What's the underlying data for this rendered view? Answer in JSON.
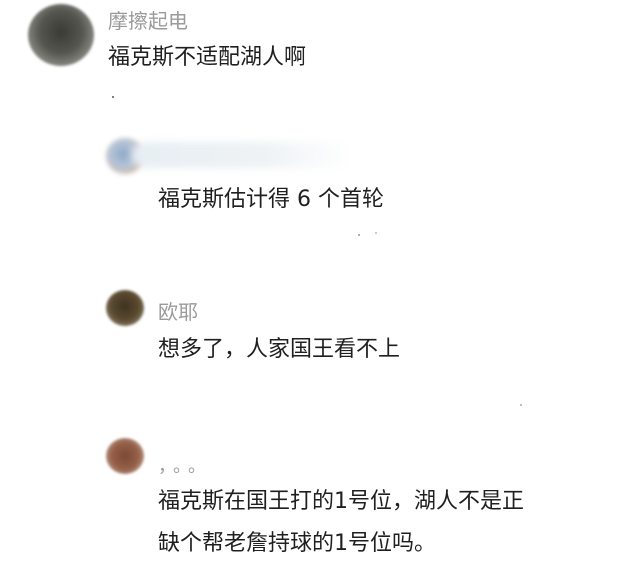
{
  "comments": [
    {
      "user": "摩擦起电",
      "lines": [
        "福克斯不适配湖人啊"
      ]
    },
    {
      "user": "",
      "lines": [
        "福克斯估计得 6 个首轮"
      ]
    },
    {
      "user": "欧耶",
      "lines": [
        "想多了，人家国王看不上"
      ]
    },
    {
      "user": "，。。",
      "lines": [
        "福克斯在国王打的1号位，湖人不是正",
        "缺个帮老詹持球的1号位吗。"
      ]
    }
  ],
  "colors": {
    "text": "#1f1f1f",
    "username": "#9a9a9a",
    "background": "#ffffff"
  },
  "icons": [
    "avatar-image",
    "avatar-image",
    "avatar-image",
    "avatar-image"
  ]
}
